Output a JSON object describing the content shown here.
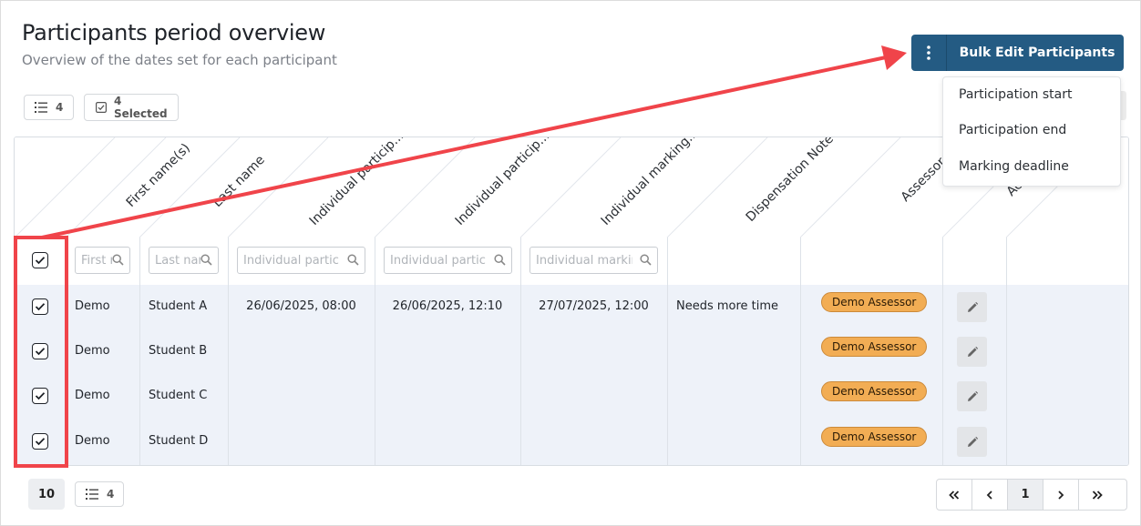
{
  "page": {
    "title": "Participants period overview",
    "subtitle": "Overview of the dates set for each participant"
  },
  "toolbar": {
    "list_count": "4",
    "selected_label": "4 Selected"
  },
  "bulk_edit": {
    "label": "Bulk Edit Participants",
    "menu_icon": "vertical-dots-icon",
    "menu": [
      "Participation start",
      "Participation end",
      "Marking deadline"
    ]
  },
  "table": {
    "columns": [
      {
        "label": "First name(s)",
        "filter_placeholder": "First name(s)"
      },
      {
        "label": "Last name",
        "filter_placeholder": "Last name"
      },
      {
        "label": "Individual particip...",
        "filter_placeholder": "Individual participation start"
      },
      {
        "label": "Individual particip...",
        "filter_placeholder": "Individual participation end"
      },
      {
        "label": "Individual marking...",
        "filter_placeholder": "Individual marking deadline"
      },
      {
        "label": "Dispensation Note",
        "filter_placeholder": ""
      },
      {
        "label": "Assessor",
        "filter_placeholder": ""
      },
      {
        "label": "Actions",
        "filter_placeholder": ""
      }
    ],
    "rows": [
      {
        "first": "Demo",
        "last": "Student A",
        "start": "26/06/2025, 08:00",
        "end": "26/06/2025, 12:10",
        "deadline": "27/07/2025, 12:00",
        "note": "Needs more time",
        "assessor": "Demo Assessor",
        "checked": true
      },
      {
        "first": "Demo",
        "last": "Student B",
        "start": "",
        "end": "",
        "deadline": "",
        "note": "",
        "assessor": "Demo Assessor",
        "checked": true
      },
      {
        "first": "Demo",
        "last": "Student C",
        "start": "",
        "end": "",
        "deadline": "",
        "note": "",
        "assessor": "Demo Assessor",
        "checked": true
      },
      {
        "first": "Demo",
        "last": "Student D",
        "start": "",
        "end": "",
        "deadline": "",
        "note": "",
        "assessor": "Demo Assessor",
        "checked": true
      }
    ]
  },
  "footer": {
    "page_size": "10",
    "total_count": "4",
    "current_page": "1",
    "pager_icons": [
      "first-page-icon",
      "previous-page-icon",
      "next-page-icon",
      "last-page-icon"
    ]
  },
  "colors": {
    "primary": "#245b83",
    "badge": "#f2ad54",
    "row_bg": "#eef2f9",
    "annotation": "#f0444a"
  }
}
